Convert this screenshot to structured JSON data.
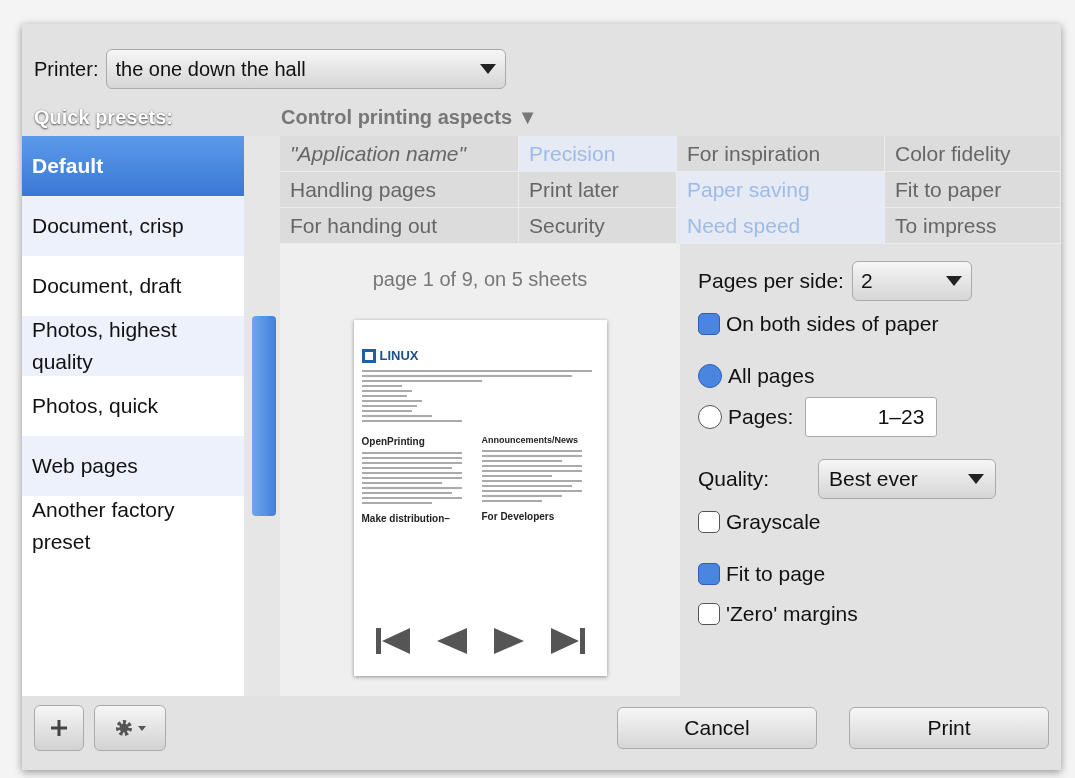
{
  "printer": {
    "label": "Printer:",
    "value": "the one down the hall"
  },
  "presets": {
    "title": "Quick presets:",
    "items": [
      {
        "label": "Default",
        "selected": true
      },
      {
        "label": "Document, crisp",
        "selected": false
      },
      {
        "label": "Document, draft",
        "selected": false
      },
      {
        "label": "Photos, highest quality",
        "selected": false
      },
      {
        "label": "Photos, quick",
        "selected": false
      },
      {
        "label": "Web pages",
        "selected": false
      },
      {
        "label": "Another factory preset",
        "selected": false
      }
    ]
  },
  "aspects": {
    "title": "Control printing aspects ▼",
    "rows": [
      [
        {
          "label": "\"Application name\"",
          "kind": "application",
          "selected": false
        },
        {
          "label": "Precision",
          "kind": "aspect",
          "selected": true
        },
        {
          "label": "For inspiration",
          "kind": "aspect",
          "selected": false
        },
        {
          "label": "Color fidelity",
          "kind": "aspect",
          "selected": false
        }
      ],
      [
        {
          "label": "Handling pages",
          "kind": "aspect",
          "selected": false
        },
        {
          "label": "Print later",
          "kind": "aspect",
          "selected": false
        },
        {
          "label": "Paper saving",
          "kind": "aspect",
          "selected": true
        },
        {
          "label": "Fit to paper",
          "kind": "aspect",
          "selected": false
        }
      ],
      [
        {
          "label": "For handing out",
          "kind": "aspect",
          "selected": false
        },
        {
          "label": "Security",
          "kind": "aspect",
          "selected": false
        },
        {
          "label": "Need speed",
          "kind": "aspect",
          "selected": true
        },
        {
          "label": "To impress",
          "kind": "aspect",
          "selected": false
        }
      ]
    ]
  },
  "preview": {
    "caption": "page 1 of 9, on 5 sheets",
    "page": {
      "logo": "LINUX",
      "left_heading": "OpenPrinting",
      "right_heading": "Announcements/News",
      "right_heading_2": "For Developers",
      "left_heading_2": "Make distribution–"
    }
  },
  "options": {
    "pages_per_side": {
      "label": "Pages per side:",
      "value": "2"
    },
    "both_sides": {
      "label": "On both sides of paper",
      "checked": true
    },
    "range": [
      {
        "label": "All pages",
        "selected": true
      },
      {
        "label": "Pages:",
        "selected": false,
        "value": "1–23"
      }
    ],
    "quality": {
      "label": "Quality:",
      "value": "Best ever"
    },
    "grayscale": {
      "label": "Grayscale",
      "checked": false
    },
    "fit_to_page": {
      "label": "Fit to page",
      "checked": true
    },
    "zero_margins": {
      "label": "'Zero' margins",
      "checked": false
    }
  },
  "buttons": {
    "cancel": "Cancel",
    "print": "Print"
  }
}
